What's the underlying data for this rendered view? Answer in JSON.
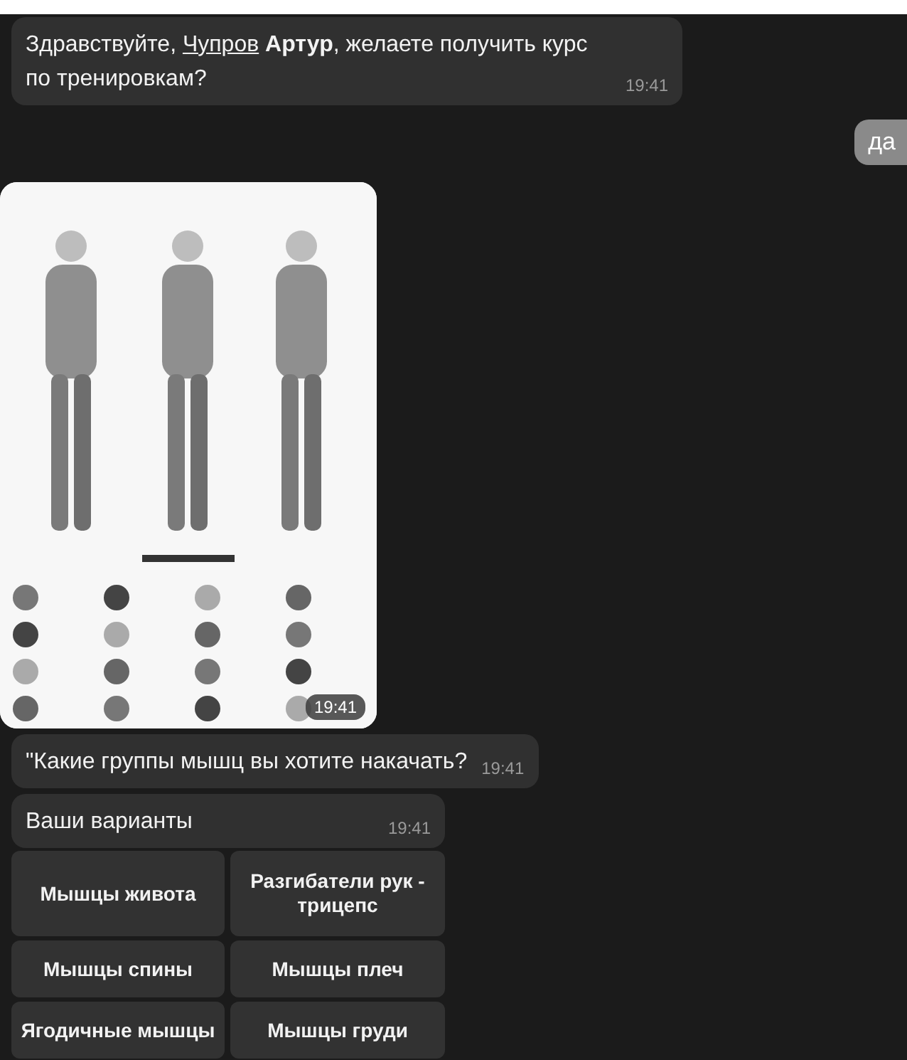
{
  "messages": [
    {
      "kind": "incoming",
      "parts": {
        "before": "Здравствуйте, ",
        "link": "Чупров",
        "after": " **Артур**, желаете получить курс по тренировкам?"
      },
      "time": "19:41"
    },
    {
      "kind": "outgoing",
      "text": "да"
    },
    {
      "time": "19:41"
    },
    {
      "kind": "incoming",
      "text": "\"Какие группы мышц вы хотите накачать?",
      "time": "19:41"
    },
    {
      "kind": "incoming",
      "text": "Ваши варианты",
      "time": "19:41"
    }
  ],
  "keyboard": [
    [
      "Мышцы живота",
      "Разгибатели рук - трицепс"
    ],
    [
      "Мышцы спины",
      "Мышцы плеч"
    ],
    [
      "Ягодичные мышцы",
      "Мышцы груди"
    ]
  ]
}
